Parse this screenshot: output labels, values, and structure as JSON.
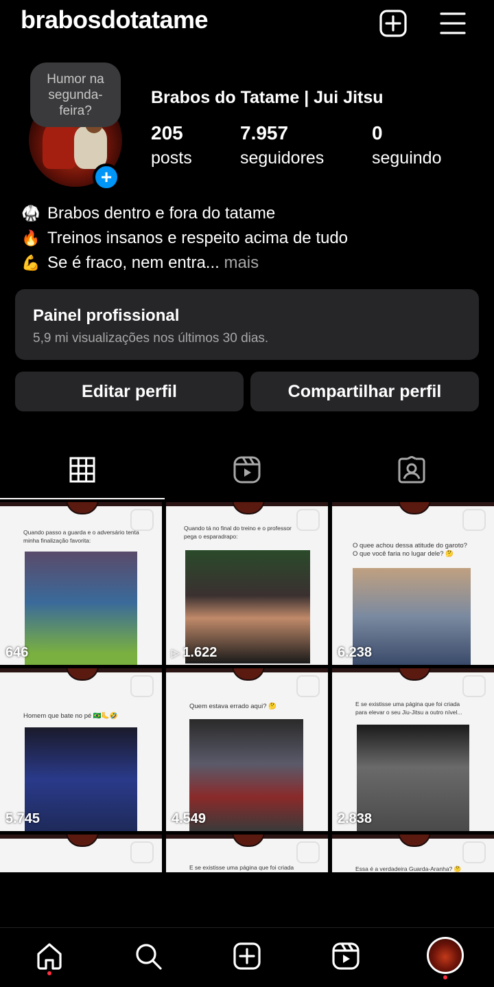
{
  "header": {
    "username": "brabosdotatame",
    "new_post_icon": "plus-square-icon",
    "menu_icon": "hamburger-icon"
  },
  "profile": {
    "note": "Humor na segunda-feira?",
    "name": "Brabos do Tatame | Jui Jitsu",
    "stats": [
      {
        "value": "205",
        "label": "posts"
      },
      {
        "value": "7.957",
        "label": "seguidores"
      },
      {
        "value": "0",
        "label": "seguindo"
      }
    ],
    "bio": [
      {
        "emoji": "🥋",
        "text": "Brabos dentro e fora do tatame"
      },
      {
        "emoji": "🔥",
        "text": "Treinos insanos e respeito acima de tudo"
      },
      {
        "emoji": "💪",
        "text": "Se é fraco, nem entra...",
        "more": "mais"
      }
    ]
  },
  "panel": {
    "title": "Painel profissional",
    "subtitle": "5,9 mi visualizações nos últimos 30 dias."
  },
  "buttons": {
    "edit": "Editar perfil",
    "share": "Compartilhar perfil"
  },
  "tabs": [
    "grid-icon",
    "reels-icon",
    "tagged-icon"
  ],
  "posts": [
    {
      "caption": "Quando passo a guarda e o adversário tenta minha finalização favorita:",
      "views": "646",
      "color": "#3a6a9a"
    },
    {
      "caption": "Quando tá no final do treino e o professor pega o esparadrapo:",
      "views": "1.622",
      "color": "#3a3030"
    },
    {
      "caption": "O quee achou dessa atitude do garoto? O que você faria no lugar dele? 🤔",
      "views": "6.238",
      "color": "#7a8aa0"
    },
    {
      "caption": "Homem que bate no pé 🇧🇷🦶🤣",
      "views": "5.745",
      "color": "#1e2a5a"
    },
    {
      "caption": "Quem estava errado aqui? 🤔",
      "views": "4.549",
      "color": "#5a5a6a"
    },
    {
      "caption": "E se existisse uma página que foi criada para elevar o seu Jiu-Jitsu a outro nível...",
      "views": "2.838",
      "color": "#6a6a6a"
    },
    {
      "caption": "",
      "views": "",
      "color": "#f4f4f4"
    },
    {
      "caption": "E se existisse uma página que foi criada para",
      "views": "",
      "color": "#f4f4f4"
    },
    {
      "caption": "Essa é a verdadeira Guarda-Aranha? 🤔",
      "views": "",
      "color": "#f4f4f4"
    }
  ],
  "nav": [
    "home-icon",
    "search-icon",
    "create-icon",
    "reels-icon",
    "profile-avatar"
  ]
}
